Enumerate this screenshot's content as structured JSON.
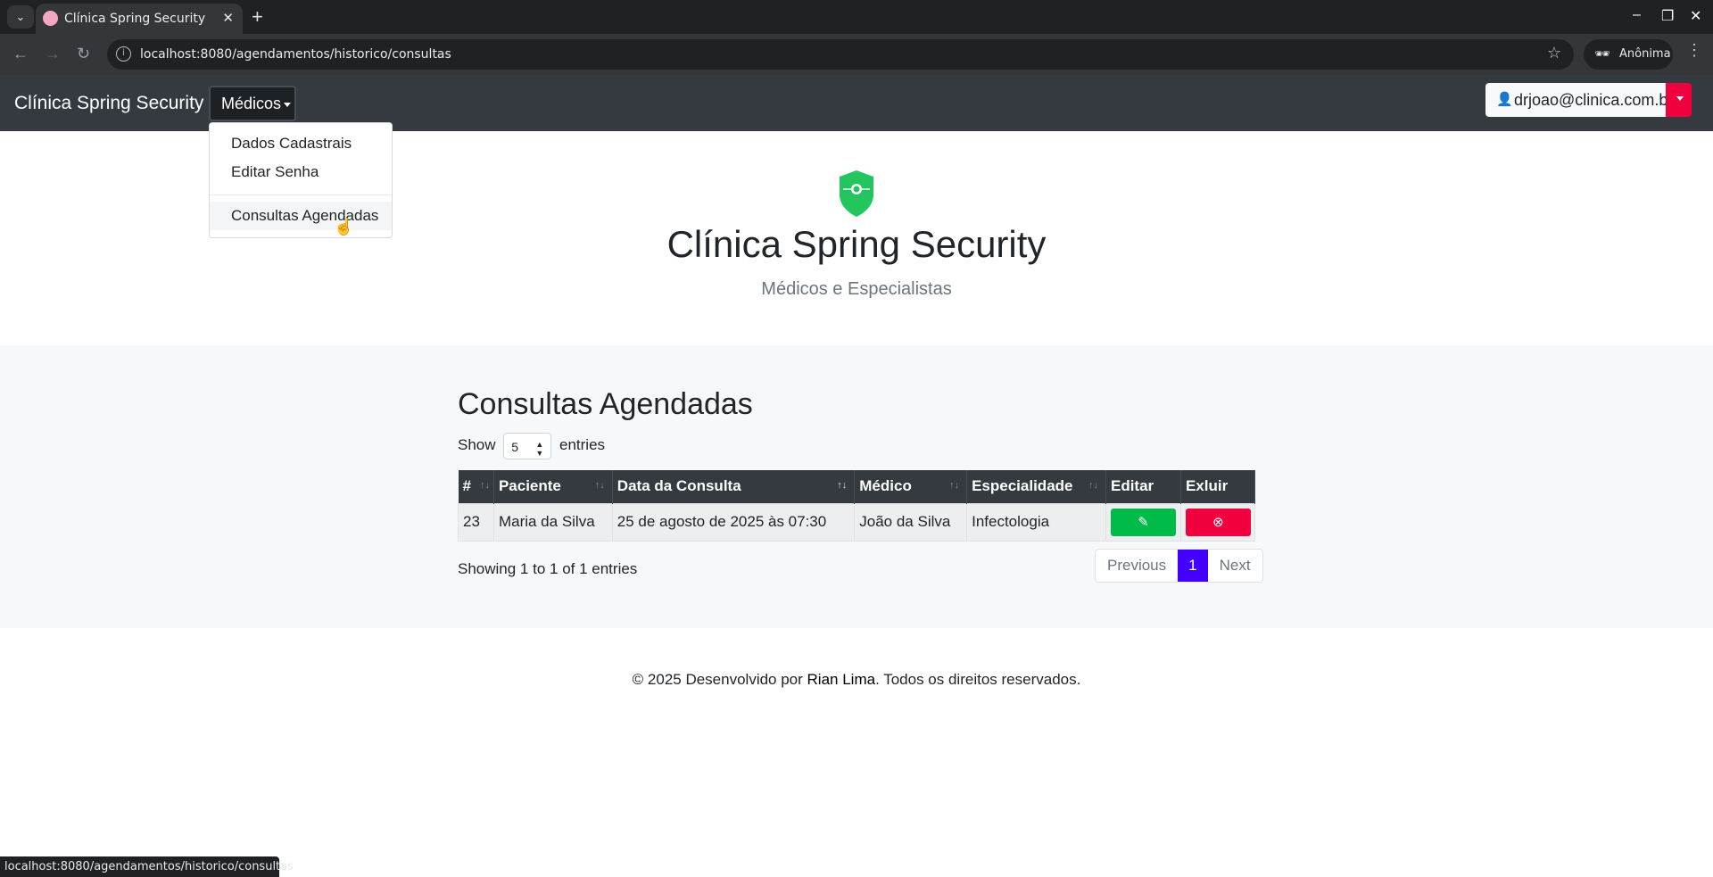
{
  "browser": {
    "tab_title": "Clínica Spring Security",
    "url": "localhost:8080/agendamentos/historico/consultas",
    "profile": "Anônima",
    "status_url": "localhost:8080/agendamentos/historico/consultas"
  },
  "navbar": {
    "brand": "Clínica Spring Security",
    "menu_label": "Médicos",
    "user_email": "drjoao@clinica.com.br",
    "dropdown": [
      "Dados Cadastrais",
      "Editar Senha",
      "Consultas Agendadas"
    ]
  },
  "hero": {
    "title": "Clínica Spring Security",
    "subtitle": "Médicos e Especialistas"
  },
  "main": {
    "heading": "Consultas Agendadas",
    "show_label": "Show",
    "entries_label": "entries",
    "page_size": "5",
    "columns": [
      "#",
      "Paciente",
      "Data da Consulta",
      "Médico",
      "Especialidade",
      "Editar",
      "Exluir"
    ],
    "rows": [
      {
        "id": "23",
        "paciente": "Maria da Silva",
        "data": "25 de agosto de 2025 às 07:30",
        "medico": "João da Silva",
        "especialidade": "Infectologia"
      }
    ],
    "info": "Showing 1 to 1 of 1 entries",
    "pagination": {
      "previous": "Previous",
      "current": "1",
      "next": "Next"
    }
  },
  "footer": {
    "prefix": "© 2025 Desenvolvido por ",
    "author": "Rian Lima",
    "suffix": ". Todos os direitos reservados."
  },
  "colors": {
    "navbar": "#343a40",
    "success": "#00bb4a",
    "danger": "#f0003f",
    "page_active": "#4400ff"
  }
}
